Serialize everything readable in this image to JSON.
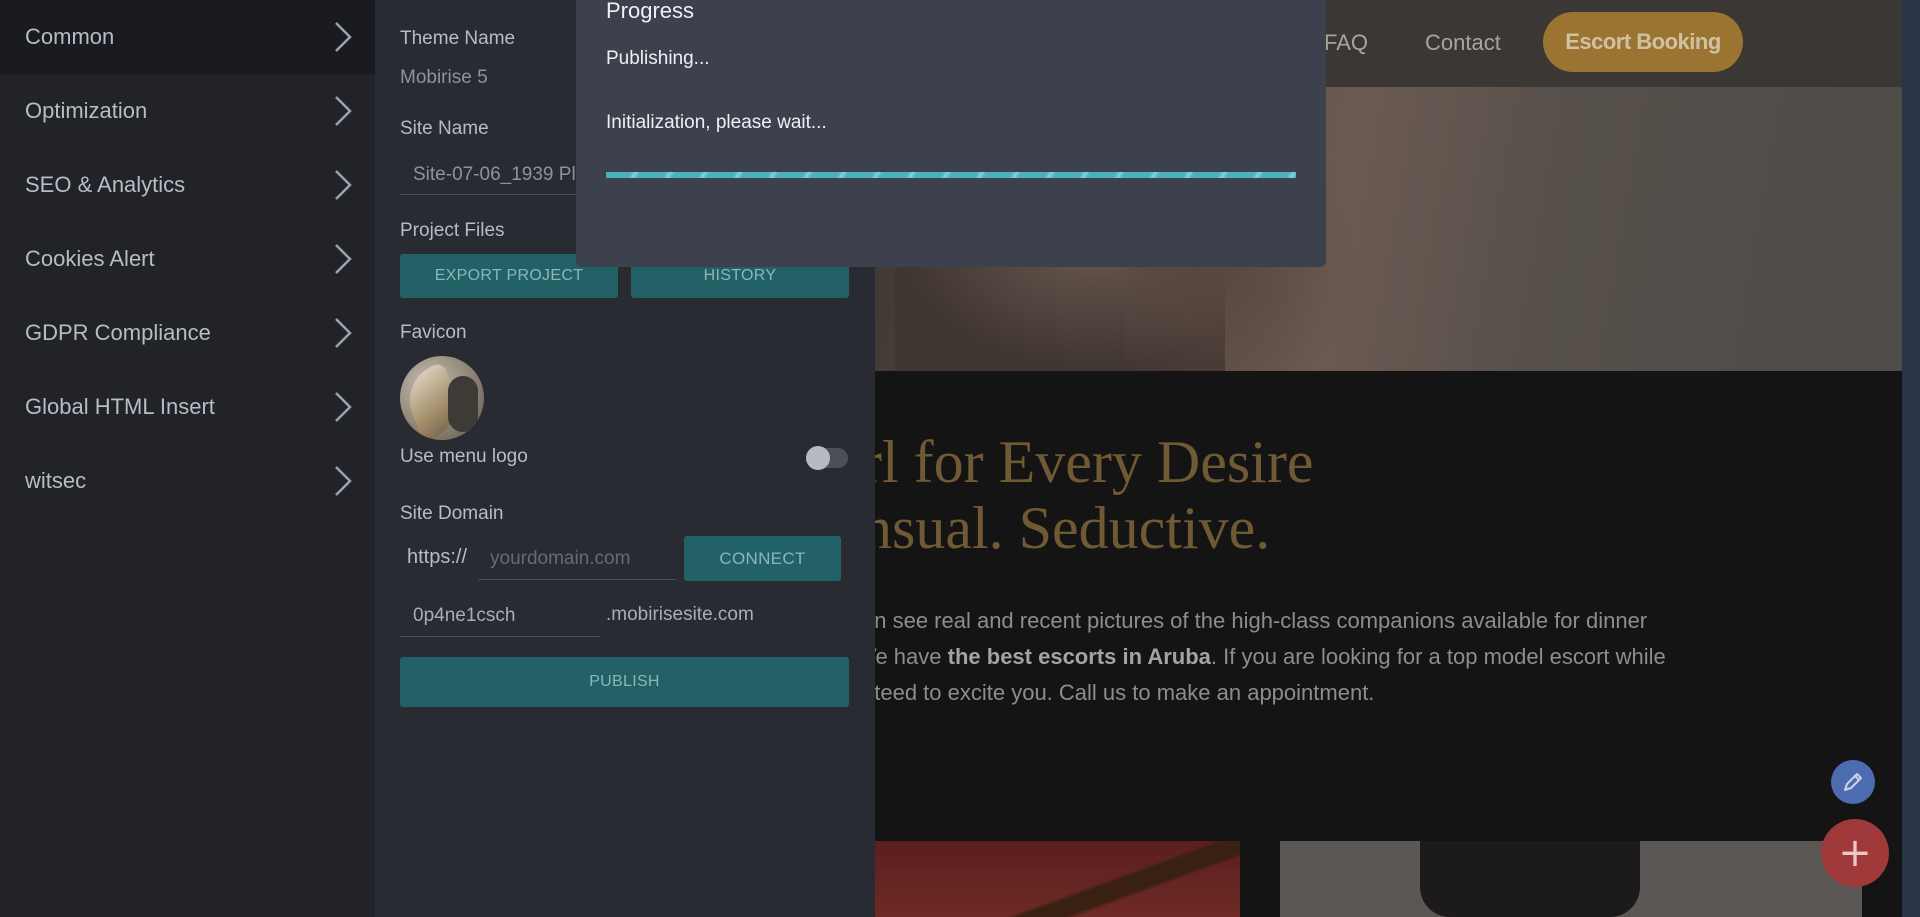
{
  "site": {
    "nav": {
      "faq": "FAQ",
      "contact": "Contact",
      "booking": "Escort Booking"
    },
    "heading_line1": "rl for Every Desire",
    "heading_line2": "nsual. Seductive.",
    "body_line1": "an see real and recent pictures of the high-class companions available for dinner",
    "body_line2_pre": "Ve have ",
    "body_line2_bold": "the best escorts in Aruba",
    "body_line2_post": ". If you are looking for a top model escort while",
    "body_line3": "nteed to excite you. Call us to make an appointment.",
    "fab_add": "+"
  },
  "menu": {
    "items": [
      {
        "label": "Common",
        "active": true
      },
      {
        "label": "Optimization"
      },
      {
        "label": "SEO & Analytics"
      },
      {
        "label": "Cookies Alert"
      },
      {
        "label": "GDPR Compliance"
      },
      {
        "label": "Global HTML Insert"
      },
      {
        "label": "witsec"
      }
    ]
  },
  "panel": {
    "theme_label": "Theme Name",
    "theme_value": "Mobirise 5",
    "site_name_label": "Site Name",
    "site_name_value": "Site-07-06_1939 Pl",
    "project_files_label": "Project Files",
    "export_button": "EXPORT PROJECT",
    "history_button": "HISTORY",
    "favicon_label": "Favicon",
    "use_menu_logo_label": "Use menu logo",
    "use_menu_logo_on": false,
    "site_domain_label": "Site Domain",
    "domain_prefix": "https://",
    "domain_placeholder": "yourdomain.com",
    "connect_button": "CONNECT",
    "subdomain_value": "0p4ne1csch",
    "subdomain_suffix": ".mobirisesite.com",
    "publish_button": "PUBLISH"
  },
  "dialog": {
    "title": "Progress",
    "status": "Publishing...",
    "message": "Initialization, please wait...",
    "progress": 1.0
  },
  "colors": {
    "accent_teal": "#226267",
    "progress_bar": "#4bb2bd",
    "booking_button": "#9a7430",
    "fab_add": "#a03a3a",
    "fab_edit": "#4d6bb0"
  }
}
